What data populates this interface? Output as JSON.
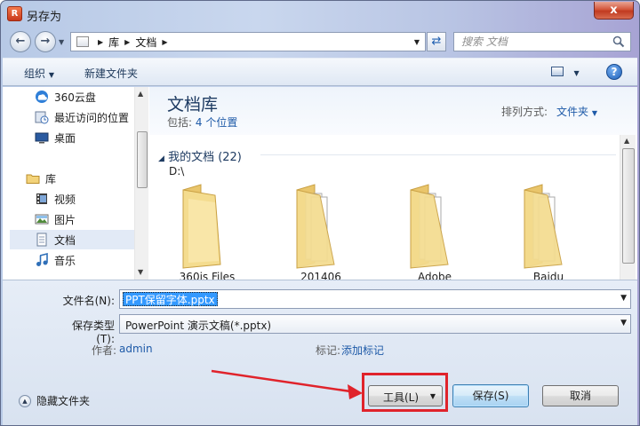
{
  "window": {
    "title": "另存为",
    "close_label": "x",
    "app_icon_letter": "R"
  },
  "address": {
    "breadcrumb": [
      "库",
      "文档"
    ],
    "search_placeholder": "搜索 文档"
  },
  "toolbar": {
    "organize_label": "组织",
    "new_folder_label": "新建文件夹"
  },
  "nav": {
    "items": [
      {
        "label": "360云盘",
        "icon": "cloud-icon"
      },
      {
        "label": "最近访问的位置",
        "icon": "recent-places-icon"
      },
      {
        "label": "桌面",
        "icon": "desktop-icon"
      },
      {
        "label": "库",
        "icon": "library-icon"
      },
      {
        "label": "视频",
        "icon": "video-icon"
      },
      {
        "label": "图片",
        "icon": "picture-icon"
      },
      {
        "label": "文档",
        "icon": "documents-icon",
        "selected": true
      },
      {
        "label": "音乐",
        "icon": "music-icon"
      }
    ]
  },
  "library": {
    "title": "文档库",
    "includes_label": "包括:",
    "includes_value": "4 个位置",
    "arrange_label": "排列方式:",
    "arrange_value": "文件夹"
  },
  "group": {
    "header": "我的文档 (22)",
    "path": "D:\\"
  },
  "folders": [
    {
      "label": "360js Files"
    },
    {
      "label": "201406"
    },
    {
      "label": "Adobe"
    },
    {
      "label": "Baidu"
    }
  ],
  "form": {
    "filename_label": "文件名(N):",
    "filename_value": "PPT保留字体.pptx",
    "savetype_label": "保存类型(T):",
    "savetype_value": "PowerPoint 演示文稿(*.pptx)",
    "author_label": "作者:",
    "author_value": "admin",
    "tags_label": "标记:",
    "tags_value": "添加标记"
  },
  "footer": {
    "hide_folders_label": "隐藏文件夹",
    "tools_label": "工具(L)",
    "save_label": "保存(S)",
    "cancel_label": "取消"
  },
  "colors": {
    "highlight": "#e0232b",
    "link": "#1e5aa8",
    "title_blue": "#1e3b62"
  }
}
